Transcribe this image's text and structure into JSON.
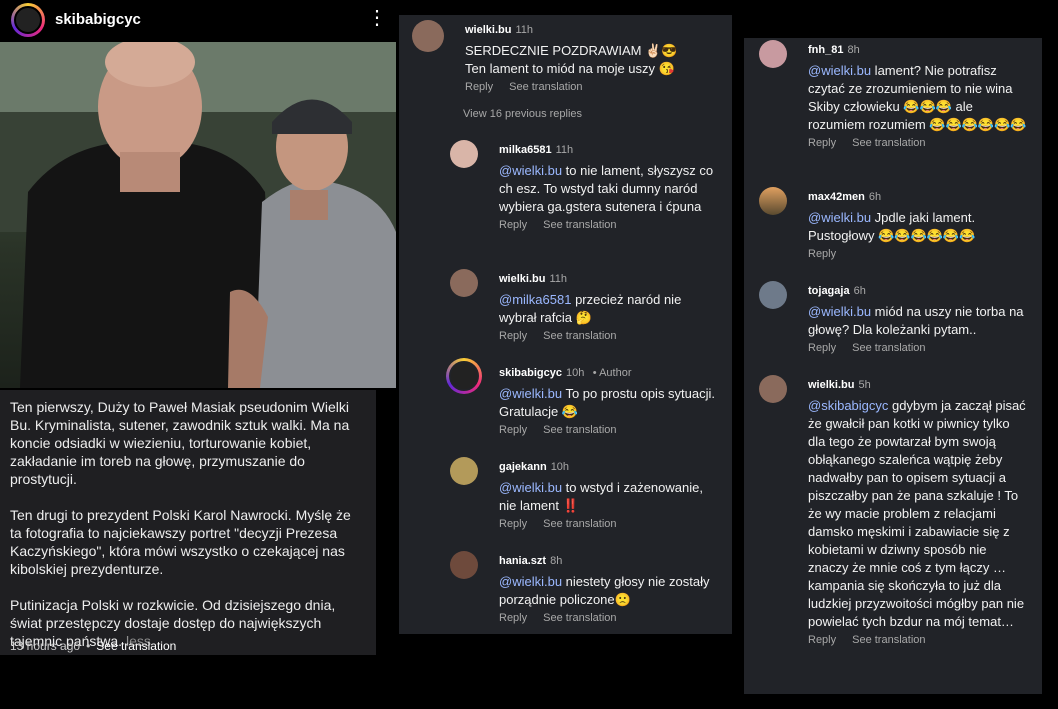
{
  "post": {
    "username": "skibabigcyc",
    "caption_p1": "Ten pierwszy, Duży to Paweł Masiak pseudonim Wielki Bu. Kryminalista, sutener,  zawodnik sztuk walki. Ma na koncie odsiadki w wiezieniu,  torturowanie kobiet, zakładanie im toreb na głowę, przymuszanie do prostytucji.",
    "caption_p2": "Ten drugi to prezydent Polski Karol Nawrocki. Myślę że ta fotografia to najciekawszy portret \"decyzji Prezesa Kaczyńskiego\", która mówi wszystko o czekającej nas kibolskiej prezydenturze.",
    "caption_p3": "Putinizacja Polski w rozkwicie. Od dzisiejszego dnia, świat przestępczy dostaje dostęp do największych tajemnic państwa.",
    "less_label": "less",
    "time_ago": "13 hours ago",
    "see_translation": "See translation"
  },
  "labels": {
    "reply": "Reply",
    "see_translation": "See translation",
    "view_previous": "View 16 previous replies"
  },
  "panel2": {
    "top": {
      "user": "wielki.bu",
      "time": "11h",
      "line1": "SERDECZNIE POZDRAWIAM ✌🏻😎",
      "line2": "Ten lament to miód na moje uszy 😘"
    },
    "replies": [
      {
        "user": "milka6581",
        "time": "11h",
        "mention": "@wielki.bu",
        "text": " to nie lament, słyszysz co ch esz. To wstyd  taki dumny naród wybiera ga.gstera  sutenera i ćpuna"
      },
      {
        "user": "wielki.bu",
        "time": "11h",
        "mention": "@milka6581",
        "text": " przecież naród nie wybrał rafcia 🤔"
      },
      {
        "user": "skibabigcyc",
        "time": "10h",
        "author": "• Author",
        "mention": "@wielki.bu",
        "text": " To po prostu opis sytuacji. Gratulacje 😂"
      },
      {
        "user": "gajekann",
        "time": "10h",
        "mention": "@wielki.bu",
        "text": " to wstyd i zażenowanie, nie lament ‼️"
      },
      {
        "user": "hania.szt",
        "time": "8h",
        "mention": "@wielki.bu",
        "text": " niestety głosy nie zostały porządnie policzone🙁"
      }
    ]
  },
  "panel3": {
    "comments": [
      {
        "user": "fnh_81",
        "time": "8h",
        "mention": "@wielki.bu",
        "text": " lament? Nie potrafisz czytać ze zrozumieniem to nie wina Skiby człowieku 😂😂😂 ale rozumiem rozumiem 😂😂😂😂😂😂"
      },
      {
        "user": "max42men",
        "time": "6h",
        "mention": "@wielki.bu",
        "text": " Jpdle jaki lament. Pustogłowy 😂😂😂😂😂😂"
      },
      {
        "user": "tojagaja",
        "time": "6h",
        "mention": "@wielki.bu",
        "text": " miód na uszy nie torba na głowę? Dla koleżanki pytam.."
      },
      {
        "user": "wielki.bu",
        "time": "5h",
        "mention": "@skibabigcyc",
        "text": " gdybym ja zaczął pisać że gwałcił pan kotki w piwnicy tylko dla tego że powtarzał bym swoją obłąkanego szaleńca wątpię żeby nadwałby pan to opisem sytuacji a piszczałby pan że pana szkaluje ! To że wy macie problem z relacjami damsko męskimi i zabawiacie się z kobietami w dziwny sposób nie znaczy że mnie coś z tym łączy … kampania się skończyła to już dla ludzkiej przyzwoitości mógłby pan nie powielać tych bzdur na mój temat…"
      }
    ]
  }
}
